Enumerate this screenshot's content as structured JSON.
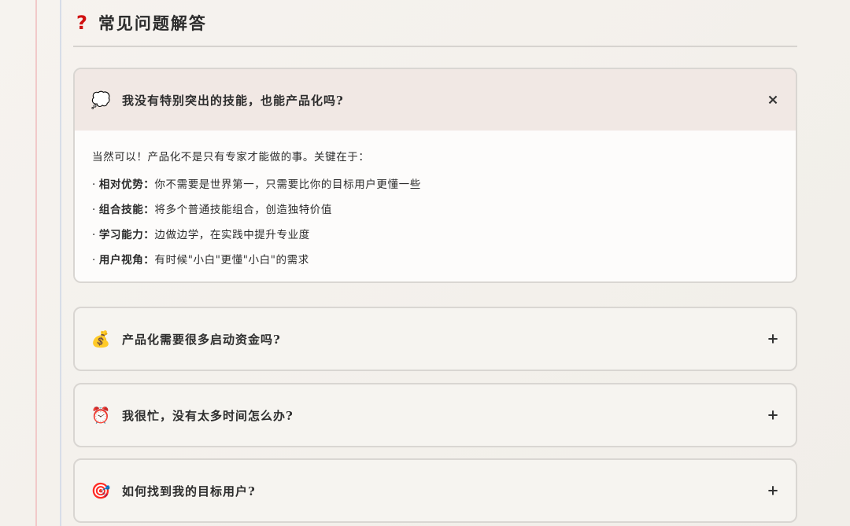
{
  "section": {
    "title": "常见问题解答",
    "title_icon": "?"
  },
  "faqs": [
    {
      "icon": "thought-bubble",
      "icon_glyph": "💭",
      "question": "我没有特别突出的技能，也能产品化吗?",
      "toggle": "×",
      "expanded": true,
      "answer": {
        "intro": "当然可以！产品化不是只有专家才能做的事。关键在于：",
        "points": [
          {
            "term": "相对优势：",
            "text": "你不需要是世界第一，只需要比你的目标用户更懂一些"
          },
          {
            "term": "组合技能：",
            "text": "将多个普通技能组合，创造独特价值"
          },
          {
            "term": "学习能力：",
            "text": "边做边学，在实践中提升专业度"
          },
          {
            "term": "用户视角：",
            "text": "有时候\"小白\"更懂\"小白\"的需求"
          }
        ]
      }
    },
    {
      "icon": "money-bag",
      "icon_glyph": "💰",
      "question": "产品化需要很多启动资金吗?",
      "toggle": "+",
      "expanded": false
    },
    {
      "icon": "alarm-clock",
      "icon_glyph": "⏰",
      "question": "我很忙，没有太多时间怎么办?",
      "toggle": "+",
      "expanded": false
    },
    {
      "icon": "target",
      "icon_glyph": "🎯",
      "question": "如何找到我的目标用户?",
      "toggle": "+",
      "expanded": false
    }
  ],
  "colors": {
    "accent_red": "#d01010",
    "open_header_bg": "#f1e8e4",
    "border": "#d9d6d2"
  }
}
